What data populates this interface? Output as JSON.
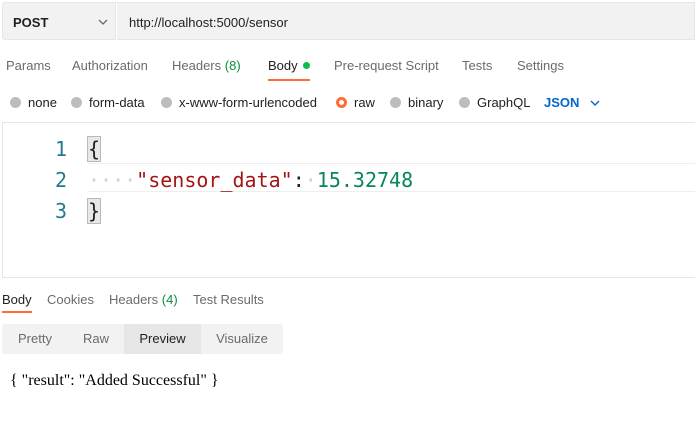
{
  "request": {
    "method": "POST",
    "url": "http://localhost:5000/sensor"
  },
  "request_tabs": [
    {
      "label": "Params",
      "count": null
    },
    {
      "label": "Authorization",
      "count": null
    },
    {
      "label": "Headers",
      "count": "(8)"
    },
    {
      "label": "Body",
      "count": null,
      "active": true,
      "indicator": "green-dot"
    },
    {
      "label": "Pre-request Script",
      "count": null
    },
    {
      "label": "Tests",
      "count": null
    },
    {
      "label": "Settings",
      "count": null
    }
  ],
  "body_options": [
    {
      "label": "none",
      "selected": false
    },
    {
      "label": "form-data",
      "selected": false
    },
    {
      "label": "x-www-form-urlencoded",
      "selected": false
    },
    {
      "label": "raw",
      "selected": true
    },
    {
      "label": "binary",
      "selected": false
    },
    {
      "label": "GraphQL",
      "selected": false
    }
  ],
  "body_format": "JSON",
  "editor": {
    "line_numbers": [
      "1",
      "2",
      "3"
    ],
    "open_brace": "{",
    "close_brace": "}",
    "key": "\"sensor_data\"",
    "colon": ":",
    "value": "15.32748"
  },
  "response_tabs": [
    {
      "label": "Body",
      "count": null,
      "active": true
    },
    {
      "label": "Cookies",
      "count": null
    },
    {
      "label": "Headers",
      "count": "(4)"
    },
    {
      "label": "Test Results",
      "count": null
    }
  ],
  "view_modes": [
    {
      "label": "Pretty",
      "active": false
    },
    {
      "label": "Raw",
      "active": false
    },
    {
      "label": "Preview",
      "active": true
    },
    {
      "label": "Visualize",
      "active": false
    }
  ],
  "response_preview": "{ \"result\": \"Added Successful\" }",
  "colors": {
    "accent": "#ff6c37",
    "count_green": "#0a8f3c",
    "json_blue": "#0265d2"
  }
}
